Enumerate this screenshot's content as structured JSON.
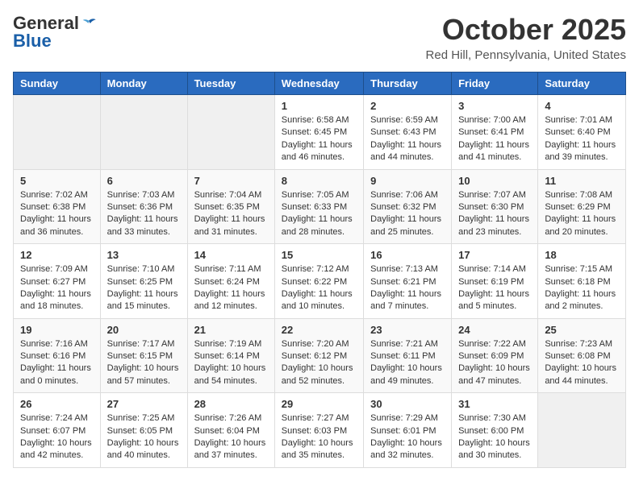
{
  "logo": {
    "general": "General",
    "blue": "Blue"
  },
  "title": "October 2025",
  "location": "Red Hill, Pennsylvania, United States",
  "days_header": [
    "Sunday",
    "Monday",
    "Tuesday",
    "Wednesday",
    "Thursday",
    "Friday",
    "Saturday"
  ],
  "weeks": [
    [
      {
        "day": "",
        "info": ""
      },
      {
        "day": "",
        "info": ""
      },
      {
        "day": "",
        "info": ""
      },
      {
        "day": "1",
        "info": "Sunrise: 6:58 AM\nSunset: 6:45 PM\nDaylight: 11 hours and 46 minutes."
      },
      {
        "day": "2",
        "info": "Sunrise: 6:59 AM\nSunset: 6:43 PM\nDaylight: 11 hours and 44 minutes."
      },
      {
        "day": "3",
        "info": "Sunrise: 7:00 AM\nSunset: 6:41 PM\nDaylight: 11 hours and 41 minutes."
      },
      {
        "day": "4",
        "info": "Sunrise: 7:01 AM\nSunset: 6:40 PM\nDaylight: 11 hours and 39 minutes."
      }
    ],
    [
      {
        "day": "5",
        "info": "Sunrise: 7:02 AM\nSunset: 6:38 PM\nDaylight: 11 hours and 36 minutes."
      },
      {
        "day": "6",
        "info": "Sunrise: 7:03 AM\nSunset: 6:36 PM\nDaylight: 11 hours and 33 minutes."
      },
      {
        "day": "7",
        "info": "Sunrise: 7:04 AM\nSunset: 6:35 PM\nDaylight: 11 hours and 31 minutes."
      },
      {
        "day": "8",
        "info": "Sunrise: 7:05 AM\nSunset: 6:33 PM\nDaylight: 11 hours and 28 minutes."
      },
      {
        "day": "9",
        "info": "Sunrise: 7:06 AM\nSunset: 6:32 PM\nDaylight: 11 hours and 25 minutes."
      },
      {
        "day": "10",
        "info": "Sunrise: 7:07 AM\nSunset: 6:30 PM\nDaylight: 11 hours and 23 minutes."
      },
      {
        "day": "11",
        "info": "Sunrise: 7:08 AM\nSunset: 6:29 PM\nDaylight: 11 hours and 20 minutes."
      }
    ],
    [
      {
        "day": "12",
        "info": "Sunrise: 7:09 AM\nSunset: 6:27 PM\nDaylight: 11 hours and 18 minutes."
      },
      {
        "day": "13",
        "info": "Sunrise: 7:10 AM\nSunset: 6:25 PM\nDaylight: 11 hours and 15 minutes."
      },
      {
        "day": "14",
        "info": "Sunrise: 7:11 AM\nSunset: 6:24 PM\nDaylight: 11 hours and 12 minutes."
      },
      {
        "day": "15",
        "info": "Sunrise: 7:12 AM\nSunset: 6:22 PM\nDaylight: 11 hours and 10 minutes."
      },
      {
        "day": "16",
        "info": "Sunrise: 7:13 AM\nSunset: 6:21 PM\nDaylight: 11 hours and 7 minutes."
      },
      {
        "day": "17",
        "info": "Sunrise: 7:14 AM\nSunset: 6:19 PM\nDaylight: 11 hours and 5 minutes."
      },
      {
        "day": "18",
        "info": "Sunrise: 7:15 AM\nSunset: 6:18 PM\nDaylight: 11 hours and 2 minutes."
      }
    ],
    [
      {
        "day": "19",
        "info": "Sunrise: 7:16 AM\nSunset: 6:16 PM\nDaylight: 11 hours and 0 minutes."
      },
      {
        "day": "20",
        "info": "Sunrise: 7:17 AM\nSunset: 6:15 PM\nDaylight: 10 hours and 57 minutes."
      },
      {
        "day": "21",
        "info": "Sunrise: 7:19 AM\nSunset: 6:14 PM\nDaylight: 10 hours and 54 minutes."
      },
      {
        "day": "22",
        "info": "Sunrise: 7:20 AM\nSunset: 6:12 PM\nDaylight: 10 hours and 52 minutes."
      },
      {
        "day": "23",
        "info": "Sunrise: 7:21 AM\nSunset: 6:11 PM\nDaylight: 10 hours and 49 minutes."
      },
      {
        "day": "24",
        "info": "Sunrise: 7:22 AM\nSunset: 6:09 PM\nDaylight: 10 hours and 47 minutes."
      },
      {
        "day": "25",
        "info": "Sunrise: 7:23 AM\nSunset: 6:08 PM\nDaylight: 10 hours and 44 minutes."
      }
    ],
    [
      {
        "day": "26",
        "info": "Sunrise: 7:24 AM\nSunset: 6:07 PM\nDaylight: 10 hours and 42 minutes."
      },
      {
        "day": "27",
        "info": "Sunrise: 7:25 AM\nSunset: 6:05 PM\nDaylight: 10 hours and 40 minutes."
      },
      {
        "day": "28",
        "info": "Sunrise: 7:26 AM\nSunset: 6:04 PM\nDaylight: 10 hours and 37 minutes."
      },
      {
        "day": "29",
        "info": "Sunrise: 7:27 AM\nSunset: 6:03 PM\nDaylight: 10 hours and 35 minutes."
      },
      {
        "day": "30",
        "info": "Sunrise: 7:29 AM\nSunset: 6:01 PM\nDaylight: 10 hours and 32 minutes."
      },
      {
        "day": "31",
        "info": "Sunrise: 7:30 AM\nSunset: 6:00 PM\nDaylight: 10 hours and 30 minutes."
      },
      {
        "day": "",
        "info": ""
      }
    ]
  ]
}
